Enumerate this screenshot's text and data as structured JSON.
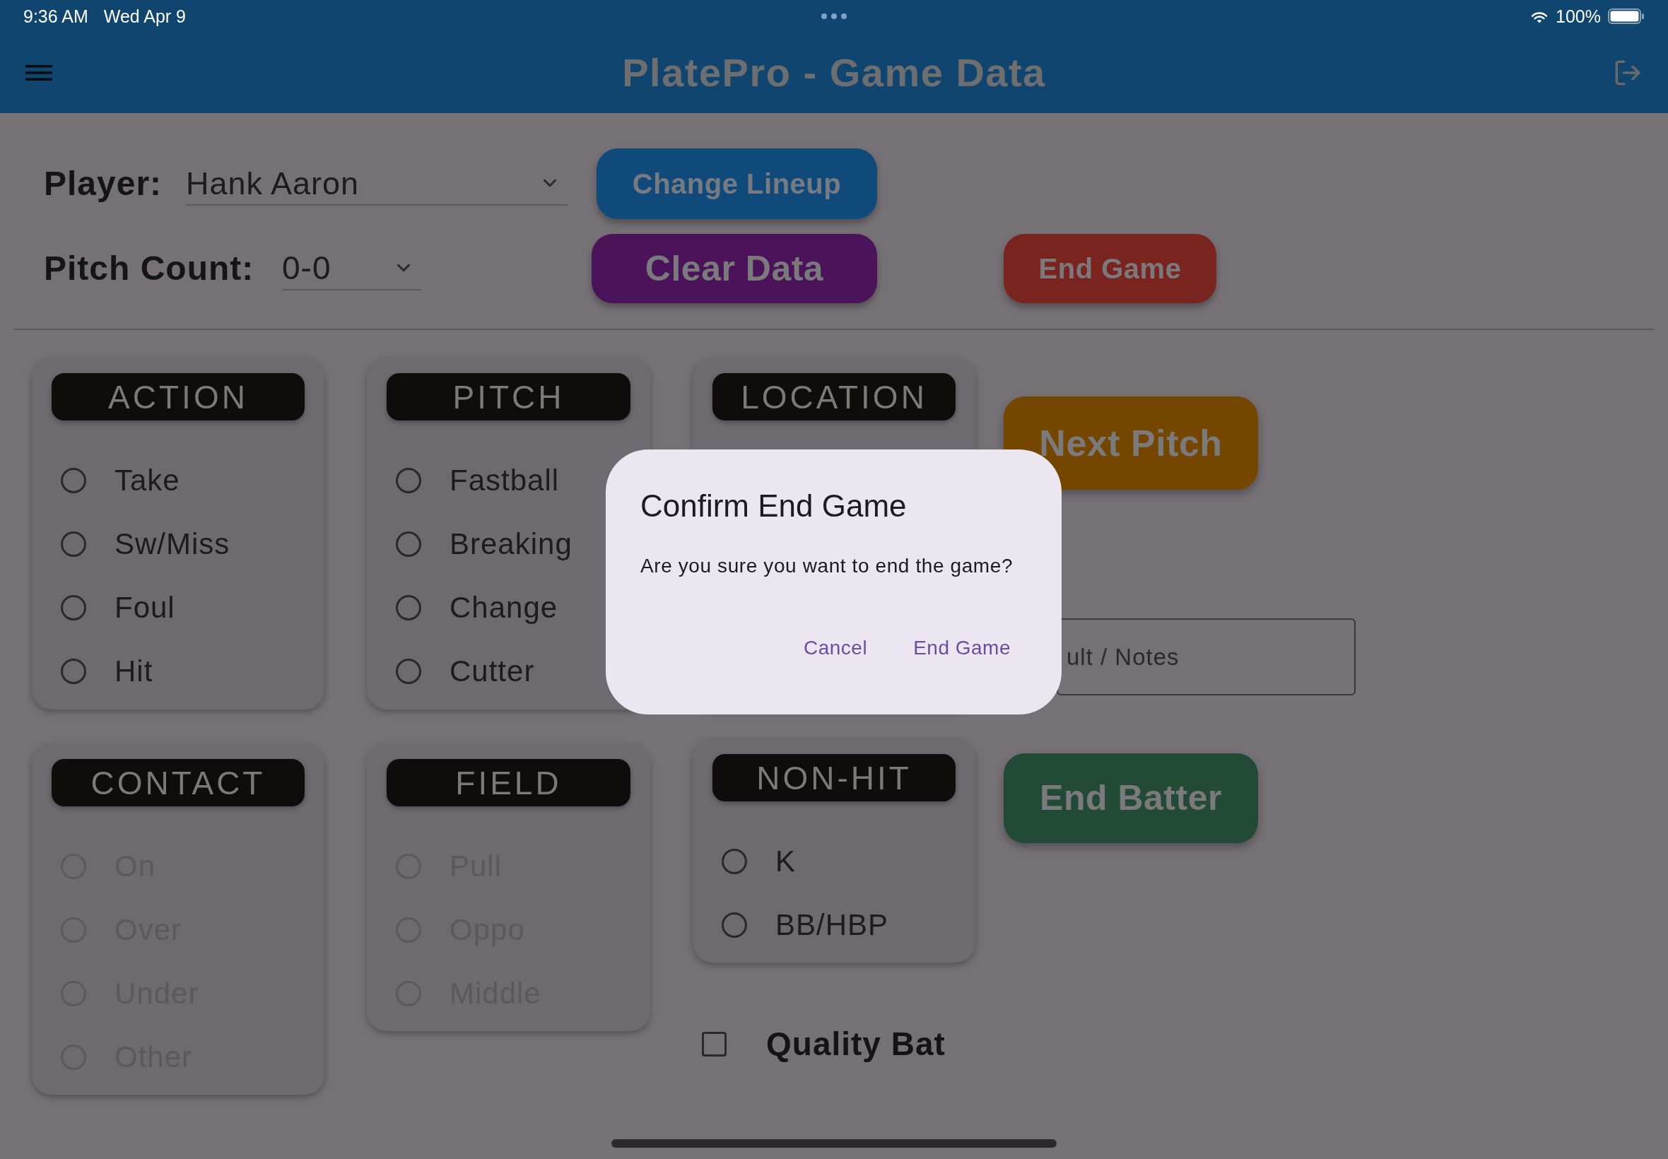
{
  "status_bar": {
    "time": "9:36 AM",
    "date": "Wed Apr 9",
    "battery": "100%"
  },
  "app_bar": {
    "title": "PlatePro - Game Data"
  },
  "player": {
    "label": "Player:",
    "value": "Hank Aaron"
  },
  "change_lineup_button": {
    "label": "Change Lineup"
  },
  "pitch_count": {
    "label": "Pitch Count:",
    "value": "0-0"
  },
  "clear_data_button": {
    "label": "Clear Data"
  },
  "end_game_button": {
    "label": "End Game"
  },
  "groups": [
    {
      "title": "ACTION",
      "options": [
        {
          "label": "Take",
          "selected": false,
          "disabled": false
        },
        {
          "label": "Sw/Miss",
          "selected": false,
          "disabled": false
        },
        {
          "label": "Foul",
          "selected": false,
          "disabled": false
        },
        {
          "label": "Hit",
          "selected": false,
          "disabled": false
        }
      ]
    },
    {
      "title": "PITCH",
      "options": [
        {
          "label": "Fastball",
          "selected": false,
          "disabled": false
        },
        {
          "label": "Breaking",
          "selected": false,
          "disabled": false
        },
        {
          "label": "Change",
          "selected": false,
          "disabled": false
        },
        {
          "label": "Cutter",
          "selected": false,
          "disabled": false
        }
      ]
    },
    {
      "title": "LOCATION"
    },
    {
      "title": "CONTACT",
      "options": [
        {
          "label": "On",
          "selected": false,
          "disabled": true
        },
        {
          "label": "Over",
          "selected": false,
          "disabled": true
        },
        {
          "label": "Under",
          "selected": false,
          "disabled": true
        },
        {
          "label": "Other",
          "selected": false,
          "disabled": true
        }
      ]
    },
    {
      "title": "FIELD",
      "options": [
        {
          "label": "Pull",
          "selected": false,
          "disabled": true
        },
        {
          "label": "Oppo",
          "selected": false,
          "disabled": true
        },
        {
          "label": "Middle",
          "selected": false,
          "disabled": true
        }
      ]
    },
    {
      "title": "NON-HIT",
      "options": [
        {
          "label": "K",
          "selected": false,
          "disabled": false
        },
        {
          "label": "BB/HBP",
          "selected": false,
          "disabled": false
        }
      ]
    }
  ],
  "quality_bat": {
    "label": "Quality Bat",
    "checked": false
  },
  "next_pitch_button": {
    "label": "Next Pitch"
  },
  "notes_field": {
    "placeholder": "ult / Notes"
  },
  "end_batter_button": {
    "label": "End Batter"
  },
  "dialog": {
    "title": "Confirm End Game",
    "message": "Are you sure you want to end the game?",
    "actions": [
      {
        "label": "Cancel"
      },
      {
        "label": "End Game"
      }
    ]
  }
}
